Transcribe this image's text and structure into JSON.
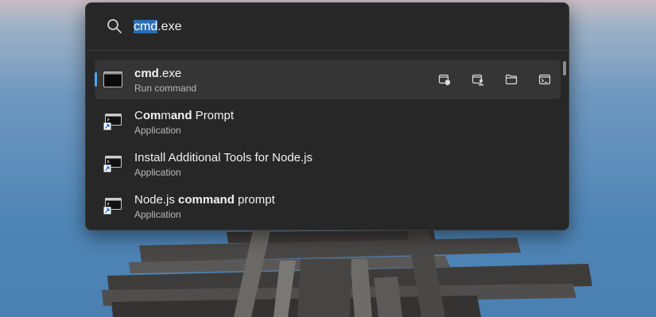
{
  "search": {
    "query_highlight": "cmd",
    "query_rest": ".exe"
  },
  "results": [
    {
      "title_parts": [
        {
          "text": "cmd",
          "bold": true
        },
        {
          "text": ".exe",
          "bold": false
        }
      ],
      "subtitle": "Run command",
      "icon": "console-window-icon",
      "selected": true
    },
    {
      "title_parts": [
        {
          "text": "C",
          "bold": false
        },
        {
          "text": "om",
          "bold": true
        },
        {
          "text": "m",
          "bold": false
        },
        {
          "text": "and",
          "bold": true
        },
        {
          "text": " Prompt",
          "bold": false
        }
      ],
      "subtitle": "Application",
      "icon": "command-prompt-shortcut-icon",
      "selected": false
    },
    {
      "title_parts": [
        {
          "text": "Install Additional Tools for Node.js",
          "bold": false
        }
      ],
      "subtitle": "Application",
      "icon": "command-prompt-shortcut-icon",
      "selected": false
    },
    {
      "title_parts": [
        {
          "text": "Node.js ",
          "bold": false
        },
        {
          "text": "command",
          "bold": true
        },
        {
          "text": " prompt",
          "bold": false
        }
      ],
      "subtitle": "Application",
      "icon": "command-prompt-shortcut-icon",
      "selected": false
    }
  ],
  "row_actions": [
    {
      "name": "run-as-admin-icon"
    },
    {
      "name": "run-as-different-user-icon"
    },
    {
      "name": "open-containing-folder-icon"
    },
    {
      "name": "open-path-in-console-icon"
    }
  ],
  "colors": {
    "panel_bg": "#272727",
    "selected_row": "#353535",
    "accent": "#4ea6f0",
    "selection_highlight": "#2a6fb4"
  }
}
